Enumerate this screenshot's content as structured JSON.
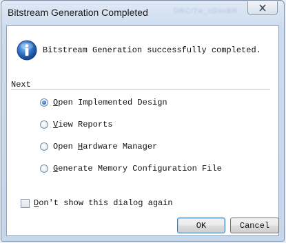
{
  "window": {
    "title": "Bitstream Generation Completed",
    "title_blurred": "DRC/Tw_nDsnBR"
  },
  "message": "Bitstream Generation successfully completed.",
  "section": {
    "label": "Next"
  },
  "options": [
    {
      "mnemonic": "O",
      "rest": "pen Implemented Design",
      "selected": true
    },
    {
      "mnemonic": "V",
      "rest": "iew Reports",
      "selected": false
    },
    {
      "prefix": "Open ",
      "mnemonic": "H",
      "rest": "ardware Manager",
      "selected": false
    },
    {
      "mnemonic": "G",
      "rest": "enerate Memory Configuration File",
      "selected": false
    }
  ],
  "checkbox": {
    "mnemonic": "D",
    "rest": "on't show this dialog again",
    "checked": false
  },
  "buttons": {
    "ok": "OK",
    "cancel": "Cancel"
  },
  "colors": {
    "accent": "#2a75c8",
    "frame": "#c7d7eb"
  },
  "icons": {
    "info": "info-icon",
    "close": "close-icon"
  }
}
